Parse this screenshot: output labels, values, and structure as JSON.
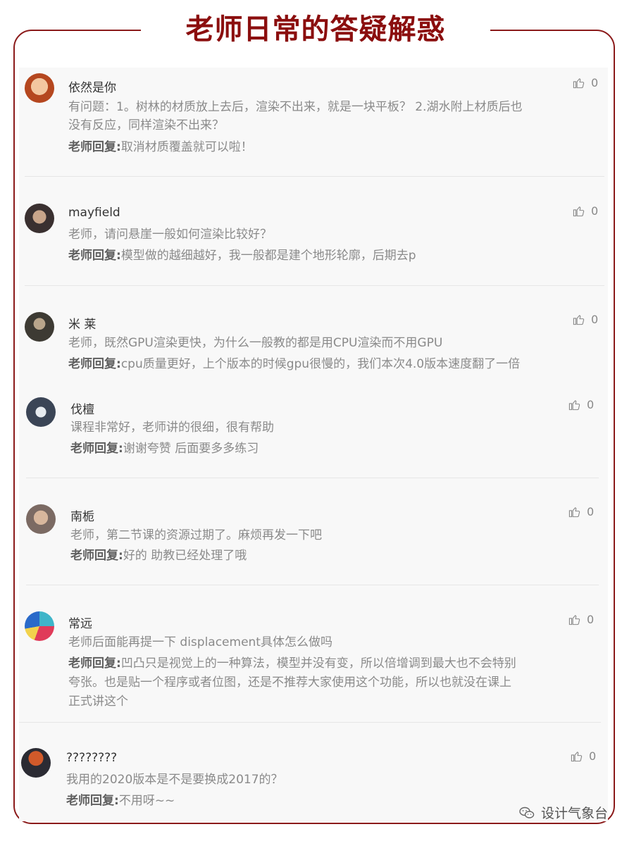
{
  "title": "老师日常的答疑解惑",
  "comments": [
    {
      "user": "依然是你",
      "text": [
        "有问题：1。树林的材质放上去后，渲染不出来，就是一块平板？ 2.湖水附上材质后也",
        "没有反应，同样渲染不出来？"
      ],
      "reply_label": "老师回复:",
      "reply": [
        "取消材质覆盖就可以啦！"
      ],
      "likes": "0"
    },
    {
      "user": "mayfield",
      "text": [
        "老师，请问悬崖一般如何渲染比较好？"
      ],
      "reply_label": "老师回复:",
      "reply": [
        "模型做的越细越好，我一般都是建个地形轮廓，后期去p"
      ],
      "likes": "0"
    },
    {
      "user": "米 莱",
      "text": [
        "老师，既然GPU渲染更快，为什么一般教的都是用CPU渲染而不用GPU"
      ],
      "reply_label": "老师回复:",
      "reply": [
        "cpu质量更好，上个版本的时候gpu很慢的，我们本次4.0版本速度翻了一倍"
      ],
      "likes": "0"
    },
    {
      "user": "伐檀",
      "text": [
        "课程非常好，老师讲的很细，很有帮助"
      ],
      "reply_label": "老师回复:",
      "reply": [
        "谢谢夸赞 后面要多多练习"
      ],
      "likes": "0"
    },
    {
      "user": "南栀",
      "text": [
        "老师，第二节课的资源过期了。麻烦再发一下吧"
      ],
      "reply_label": "老师回复:",
      "reply": [
        "好的 助教已经处理了哦"
      ],
      "likes": "0"
    },
    {
      "user": "常远",
      "text": [
        "老师后面能再提一下 displacement具体怎么做吗"
      ],
      "reply_label": "老师回复:",
      "reply": [
        "凹凸只是视觉上的一种算法，模型并没有变，所以倍增调到最大也不会特别",
        "夸张。也是贴一个程序或者位图，还是不推荐大家使用这个功能，所以也就没在课上",
        "正式讲这个"
      ],
      "likes": "0"
    },
    {
      "user": "????????",
      "text": [
        "我用的2020版本是不是要换成2017的？"
      ],
      "reply_label": "老师回复:",
      "reply": [
        "不用呀~~"
      ],
      "likes": "0"
    }
  ],
  "watermark": "设计气象台",
  "colors": {
    "accent": "#8b0e0e",
    "frame": "#8b1a1a"
  }
}
